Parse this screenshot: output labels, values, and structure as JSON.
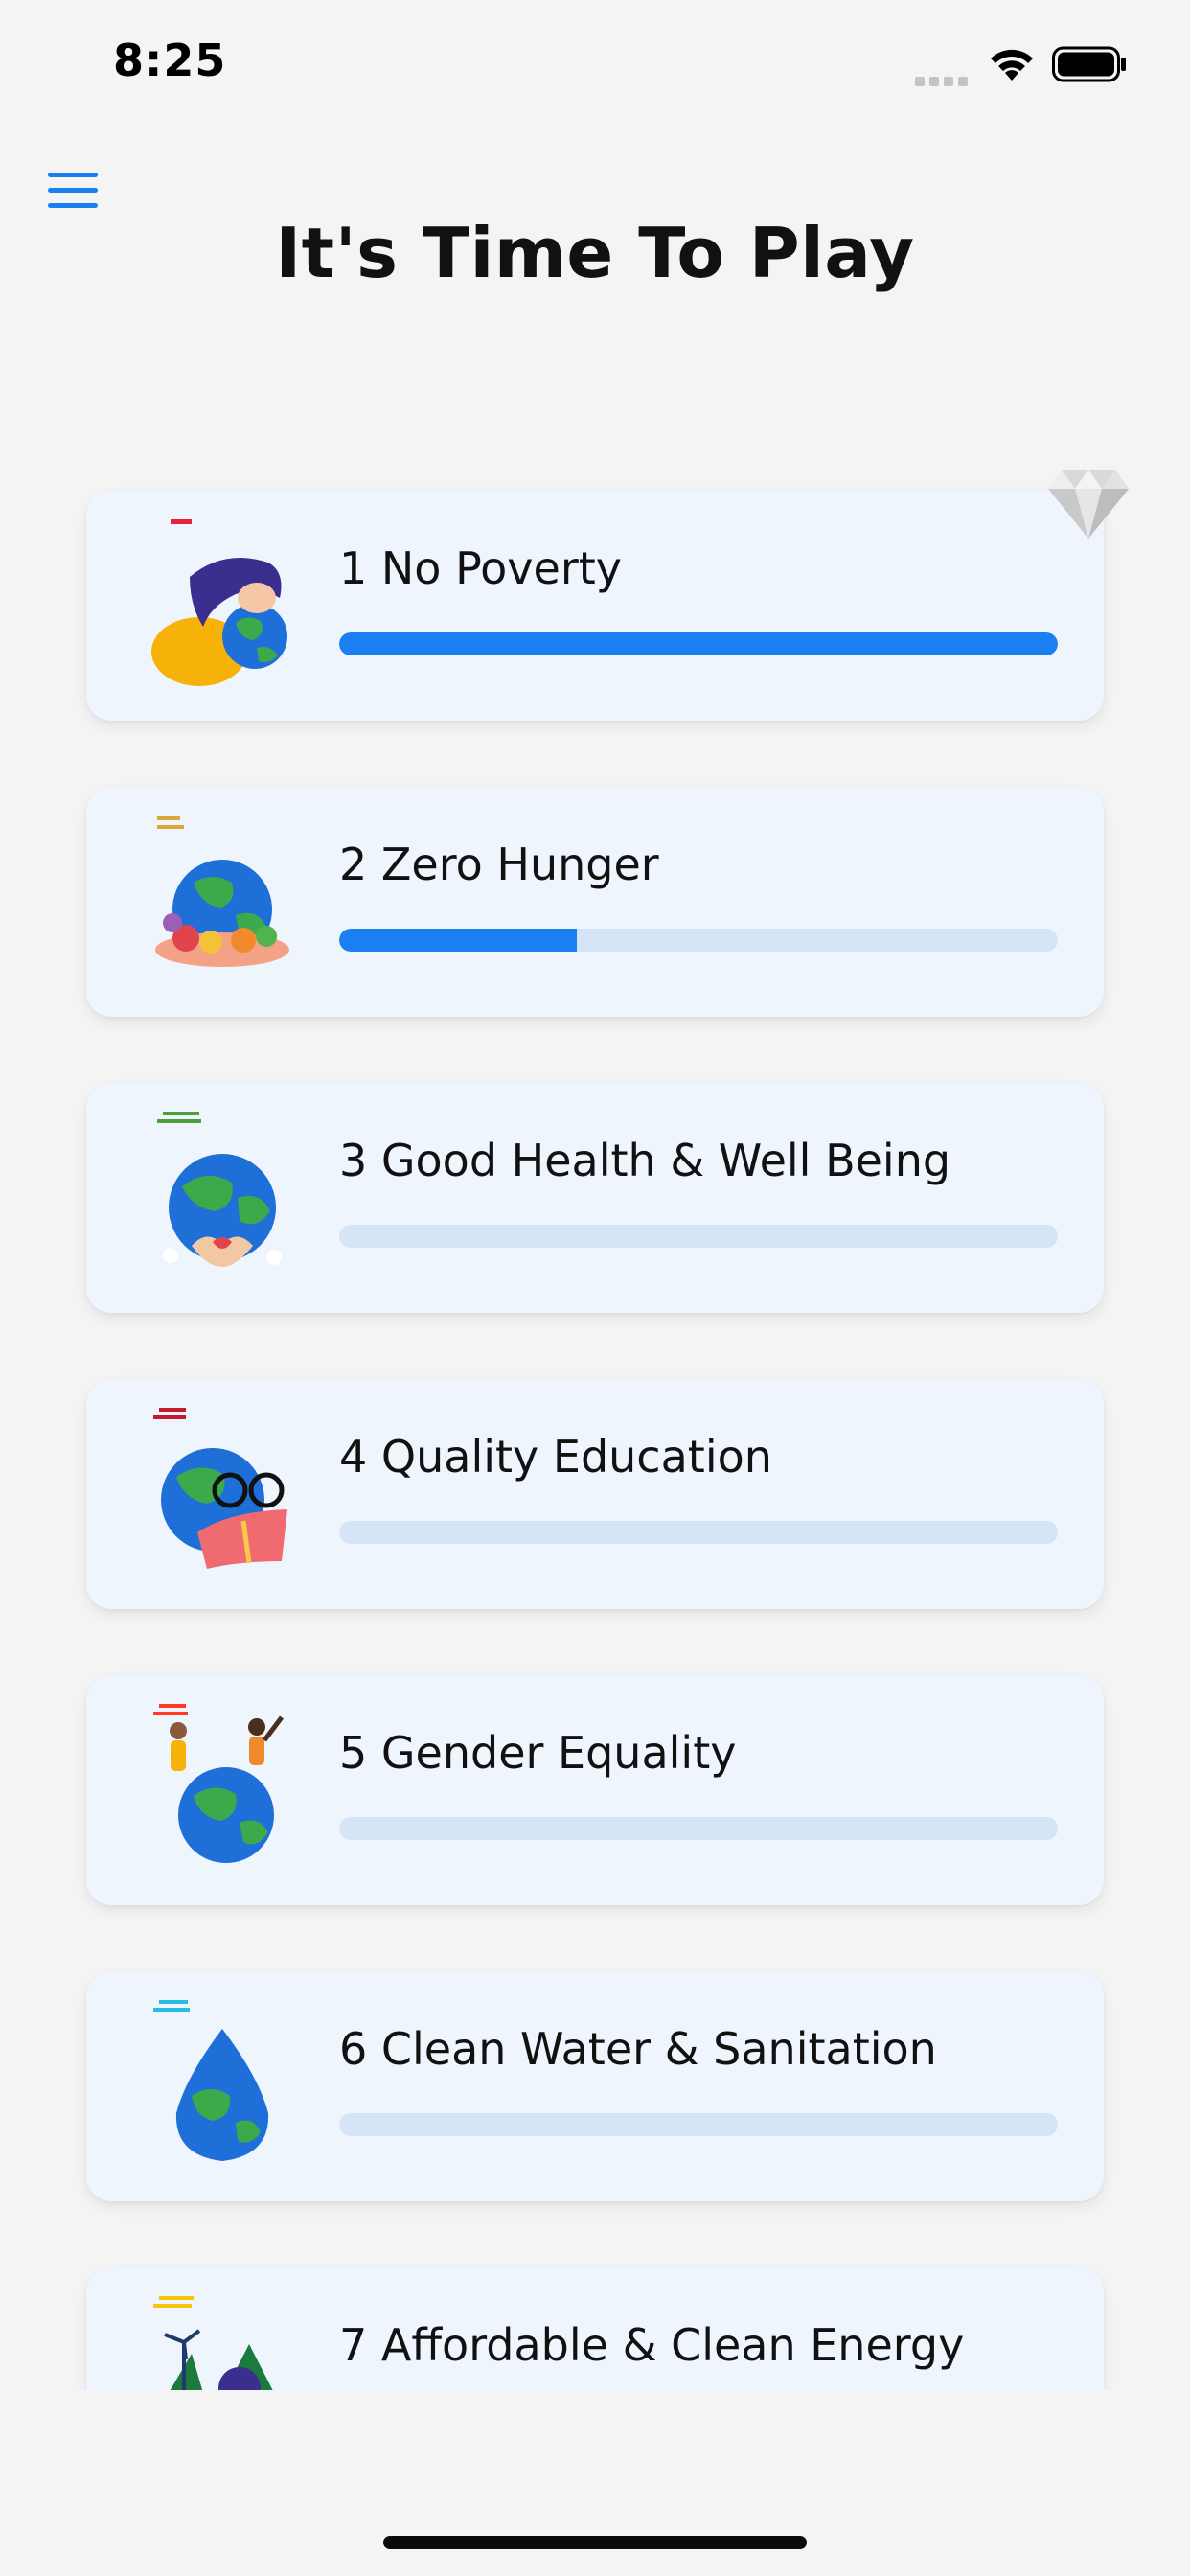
{
  "status_bar": {
    "time": "8:25"
  },
  "header": {
    "menu_icon": "hamburger-menu-icon",
    "title": "It's Time To Play"
  },
  "goals": [
    {
      "number": "1",
      "label": "1 No Poverty",
      "progress": 1.0,
      "icon": "sdg-no-poverty-icon"
    },
    {
      "number": "2",
      "label": "2 Zero Hunger",
      "progress": 0.33,
      "icon": "sdg-zero-hunger-icon"
    },
    {
      "number": "3",
      "label": "3 Good Health & Well Being",
      "progress": 0.0,
      "icon": "sdg-good-health-icon"
    },
    {
      "number": "4",
      "label": "4 Quality Education",
      "progress": 0.0,
      "icon": "sdg-quality-education-icon"
    },
    {
      "number": "5",
      "label": "5 Gender Equality",
      "progress": 0.0,
      "icon": "sdg-gender-equality-icon"
    },
    {
      "number": "6",
      "label": "6 Clean Water & Sanitation",
      "progress": 0.0,
      "icon": "sdg-clean-water-icon"
    },
    {
      "number": "7",
      "label": "7 Affordable & Clean Energy",
      "progress": 0.0,
      "icon": "sdg-clean-energy-icon"
    }
  ],
  "badge": {
    "icon": "diamond-icon"
  },
  "colors": {
    "accent": "#1a7ff0",
    "track": "#d5e5f7",
    "card": "#eef5fd",
    "background": "#f4f4f4"
  }
}
